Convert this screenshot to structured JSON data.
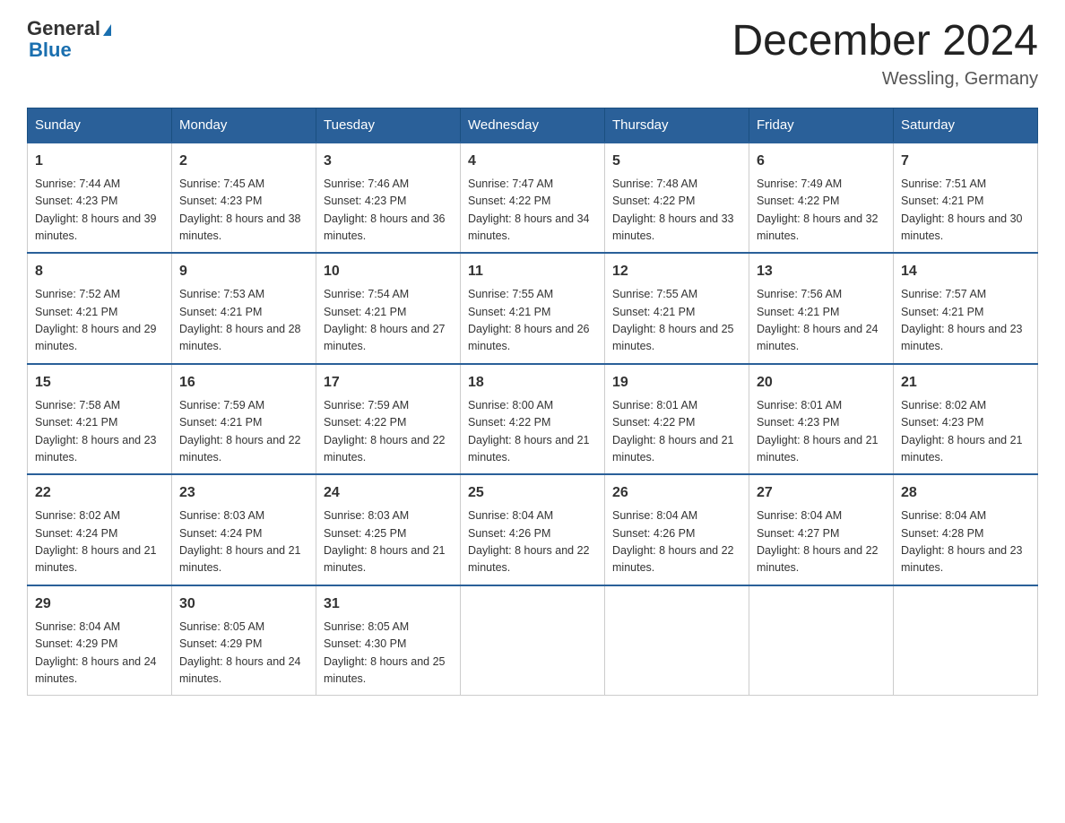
{
  "header": {
    "logo_line1": "General",
    "logo_line2": "Blue",
    "month_year": "December 2024",
    "location": "Wessling, Germany"
  },
  "days_of_week": [
    "Sunday",
    "Monday",
    "Tuesday",
    "Wednesday",
    "Thursday",
    "Friday",
    "Saturday"
  ],
  "weeks": [
    [
      {
        "day": "1",
        "sunrise": "7:44 AM",
        "sunset": "4:23 PM",
        "daylight": "8 hours and 39 minutes."
      },
      {
        "day": "2",
        "sunrise": "7:45 AM",
        "sunset": "4:23 PM",
        "daylight": "8 hours and 38 minutes."
      },
      {
        "day": "3",
        "sunrise": "7:46 AM",
        "sunset": "4:23 PM",
        "daylight": "8 hours and 36 minutes."
      },
      {
        "day": "4",
        "sunrise": "7:47 AM",
        "sunset": "4:22 PM",
        "daylight": "8 hours and 34 minutes."
      },
      {
        "day": "5",
        "sunrise": "7:48 AM",
        "sunset": "4:22 PM",
        "daylight": "8 hours and 33 minutes."
      },
      {
        "day": "6",
        "sunrise": "7:49 AM",
        "sunset": "4:22 PM",
        "daylight": "8 hours and 32 minutes."
      },
      {
        "day": "7",
        "sunrise": "7:51 AM",
        "sunset": "4:21 PM",
        "daylight": "8 hours and 30 minutes."
      }
    ],
    [
      {
        "day": "8",
        "sunrise": "7:52 AM",
        "sunset": "4:21 PM",
        "daylight": "8 hours and 29 minutes."
      },
      {
        "day": "9",
        "sunrise": "7:53 AM",
        "sunset": "4:21 PM",
        "daylight": "8 hours and 28 minutes."
      },
      {
        "day": "10",
        "sunrise": "7:54 AM",
        "sunset": "4:21 PM",
        "daylight": "8 hours and 27 minutes."
      },
      {
        "day": "11",
        "sunrise": "7:55 AM",
        "sunset": "4:21 PM",
        "daylight": "8 hours and 26 minutes."
      },
      {
        "day": "12",
        "sunrise": "7:55 AM",
        "sunset": "4:21 PM",
        "daylight": "8 hours and 25 minutes."
      },
      {
        "day": "13",
        "sunrise": "7:56 AM",
        "sunset": "4:21 PM",
        "daylight": "8 hours and 24 minutes."
      },
      {
        "day": "14",
        "sunrise": "7:57 AM",
        "sunset": "4:21 PM",
        "daylight": "8 hours and 23 minutes."
      }
    ],
    [
      {
        "day": "15",
        "sunrise": "7:58 AM",
        "sunset": "4:21 PM",
        "daylight": "8 hours and 23 minutes."
      },
      {
        "day": "16",
        "sunrise": "7:59 AM",
        "sunset": "4:21 PM",
        "daylight": "8 hours and 22 minutes."
      },
      {
        "day": "17",
        "sunrise": "7:59 AM",
        "sunset": "4:22 PM",
        "daylight": "8 hours and 22 minutes."
      },
      {
        "day": "18",
        "sunrise": "8:00 AM",
        "sunset": "4:22 PM",
        "daylight": "8 hours and 21 minutes."
      },
      {
        "day": "19",
        "sunrise": "8:01 AM",
        "sunset": "4:22 PM",
        "daylight": "8 hours and 21 minutes."
      },
      {
        "day": "20",
        "sunrise": "8:01 AM",
        "sunset": "4:23 PM",
        "daylight": "8 hours and 21 minutes."
      },
      {
        "day": "21",
        "sunrise": "8:02 AM",
        "sunset": "4:23 PM",
        "daylight": "8 hours and 21 minutes."
      }
    ],
    [
      {
        "day": "22",
        "sunrise": "8:02 AM",
        "sunset": "4:24 PM",
        "daylight": "8 hours and 21 minutes."
      },
      {
        "day": "23",
        "sunrise": "8:03 AM",
        "sunset": "4:24 PM",
        "daylight": "8 hours and 21 minutes."
      },
      {
        "day": "24",
        "sunrise": "8:03 AM",
        "sunset": "4:25 PM",
        "daylight": "8 hours and 21 minutes."
      },
      {
        "day": "25",
        "sunrise": "8:04 AM",
        "sunset": "4:26 PM",
        "daylight": "8 hours and 22 minutes."
      },
      {
        "day": "26",
        "sunrise": "8:04 AM",
        "sunset": "4:26 PM",
        "daylight": "8 hours and 22 minutes."
      },
      {
        "day": "27",
        "sunrise": "8:04 AM",
        "sunset": "4:27 PM",
        "daylight": "8 hours and 22 minutes."
      },
      {
        "day": "28",
        "sunrise": "8:04 AM",
        "sunset": "4:28 PM",
        "daylight": "8 hours and 23 minutes."
      }
    ],
    [
      {
        "day": "29",
        "sunrise": "8:04 AM",
        "sunset": "4:29 PM",
        "daylight": "8 hours and 24 minutes."
      },
      {
        "day": "30",
        "sunrise": "8:05 AM",
        "sunset": "4:29 PM",
        "daylight": "8 hours and 24 minutes."
      },
      {
        "day": "31",
        "sunrise": "8:05 AM",
        "sunset": "4:30 PM",
        "daylight": "8 hours and 25 minutes."
      },
      null,
      null,
      null,
      null
    ]
  ]
}
